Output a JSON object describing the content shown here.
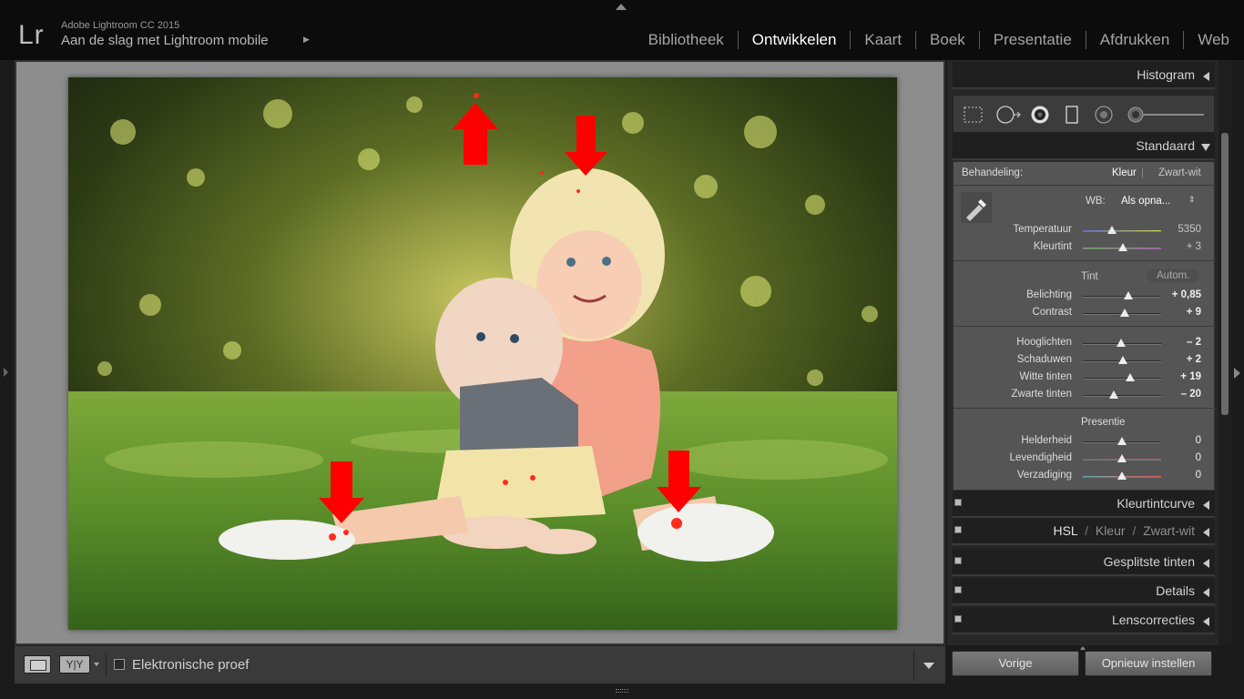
{
  "app": {
    "logo": "Lr",
    "version": "Adobe Lightroom CC 2015",
    "identity_plate": "Aan de slag met Lightroom mobile",
    "identity_arrow": "▶"
  },
  "modules": [
    "Bibliotheek",
    "Ontwikkelen",
    "Kaart",
    "Boek",
    "Presentatie",
    "Afdrukken",
    "Web"
  ],
  "active_module": "Ontwikkelen",
  "toolbar": {
    "compare_label": "Y|Y",
    "softproof_label": "Elektronische proef"
  },
  "panels": {
    "histogram": "Histogram",
    "basic": {
      "title": "Standaard",
      "treatment_label": "Behandeling:",
      "treatment_color": "Kleur",
      "treatment_bw": "Zwart-wit",
      "wb_label": "WB:",
      "wb_value": "Als opna...",
      "tone_label": "Tint",
      "auto_label": "Autom.",
      "presence_label": "Presentie",
      "wb_sliders": [
        {
          "label": "Temperatuur",
          "value": "5350",
          "pos": 0.37
        },
        {
          "label": "Kleurtint",
          "value": "+ 3",
          "pos": 0.51
        }
      ],
      "tone_sliders": [
        {
          "label": "Belichting",
          "value": "+ 0,85",
          "pos": 0.58
        },
        {
          "label": "Contrast",
          "value": "+ 9",
          "pos": 0.54
        }
      ],
      "detail_sliders": [
        {
          "label": "Hooglichten",
          "value": "– 2",
          "pos": 0.49
        },
        {
          "label": "Schaduwen",
          "value": "+ 2",
          "pos": 0.51
        },
        {
          "label": "Witte tinten",
          "value": "+ 19",
          "pos": 0.6
        },
        {
          "label": "Zwarte tinten",
          "value": "– 20",
          "pos": 0.4
        }
      ],
      "presence_sliders": [
        {
          "label": "Helderheid",
          "value": "0",
          "pos": 0.5
        },
        {
          "label": "Levendigheid",
          "value": "0",
          "pos": 0.5
        },
        {
          "label": "Verzadiging",
          "value": "0",
          "pos": 0.5
        }
      ]
    },
    "tone_curve": "Kleurtintcurve",
    "hsl": {
      "a": "HSL",
      "sep1": "/",
      "b": "Kleur",
      "sep2": "/",
      "c": "Zwart-wit"
    },
    "split_toning": "Gesplitste tinten",
    "details": "Details",
    "lens": "Lenscorrecties"
  },
  "buttons": {
    "previous": "Vorige",
    "reset": "Opnieuw instellen"
  },
  "colors": {
    "accent_text": "#ffffff",
    "clipping_marker": "#ff2a1a"
  }
}
